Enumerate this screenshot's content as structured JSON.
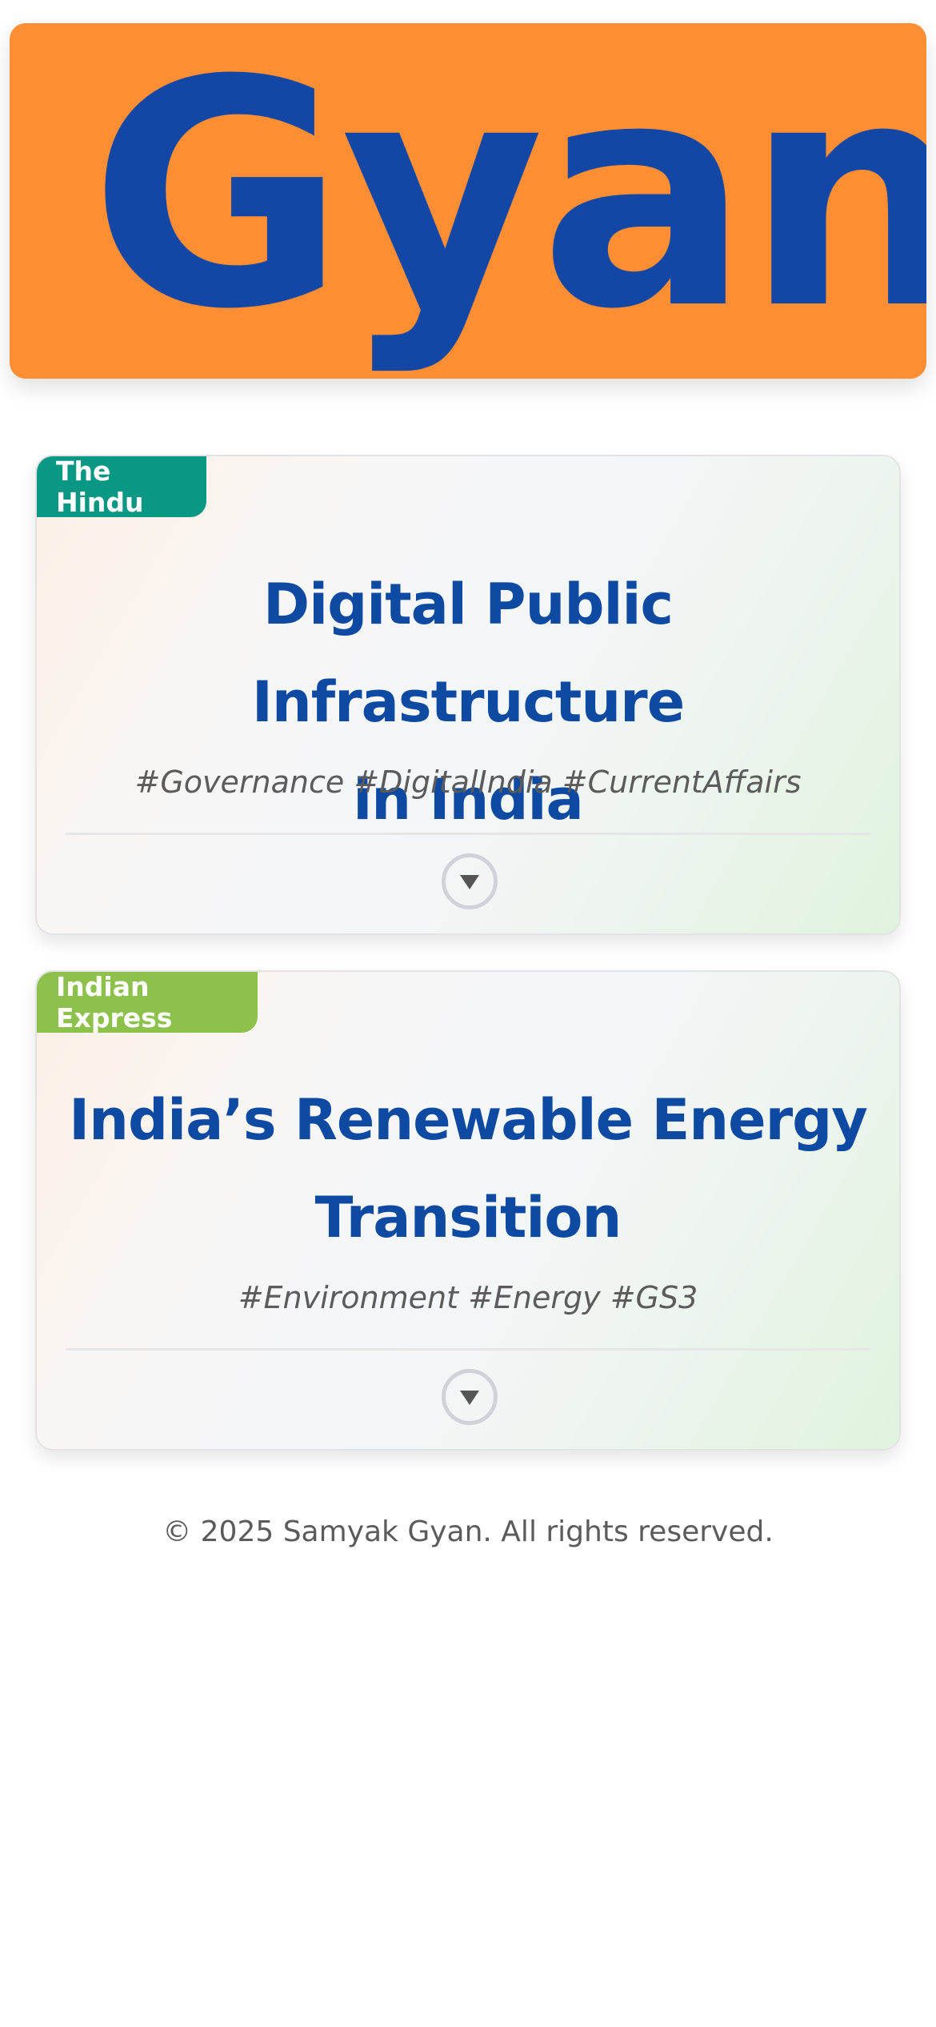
{
  "banner": {
    "logo_text": "Gyan"
  },
  "articles": [
    {
      "source": "The Hindu",
      "source_color": "#0a9784",
      "title_line1": "Digital Public Infrastructure",
      "title_line2": "in India",
      "tags": "#Governance #DigitalIndia #CurrentAffairs",
      "expand_icon": "chevron-down-icon"
    },
    {
      "source": "Indian Express",
      "source_color": "#8cc24b",
      "title_line1": "India’s Renewable Energy",
      "title_line2": "Transition",
      "tags": "#Environment #Energy #GS3",
      "expand_icon": "chevron-down-icon"
    }
  ],
  "footer": {
    "copyright": "© 2025 Samyak Gyan. All rights reserved."
  },
  "colors": {
    "banner_bg": "#fd8e33",
    "logo_blue": "#1347a6",
    "title_blue": "#0f4aa2"
  }
}
